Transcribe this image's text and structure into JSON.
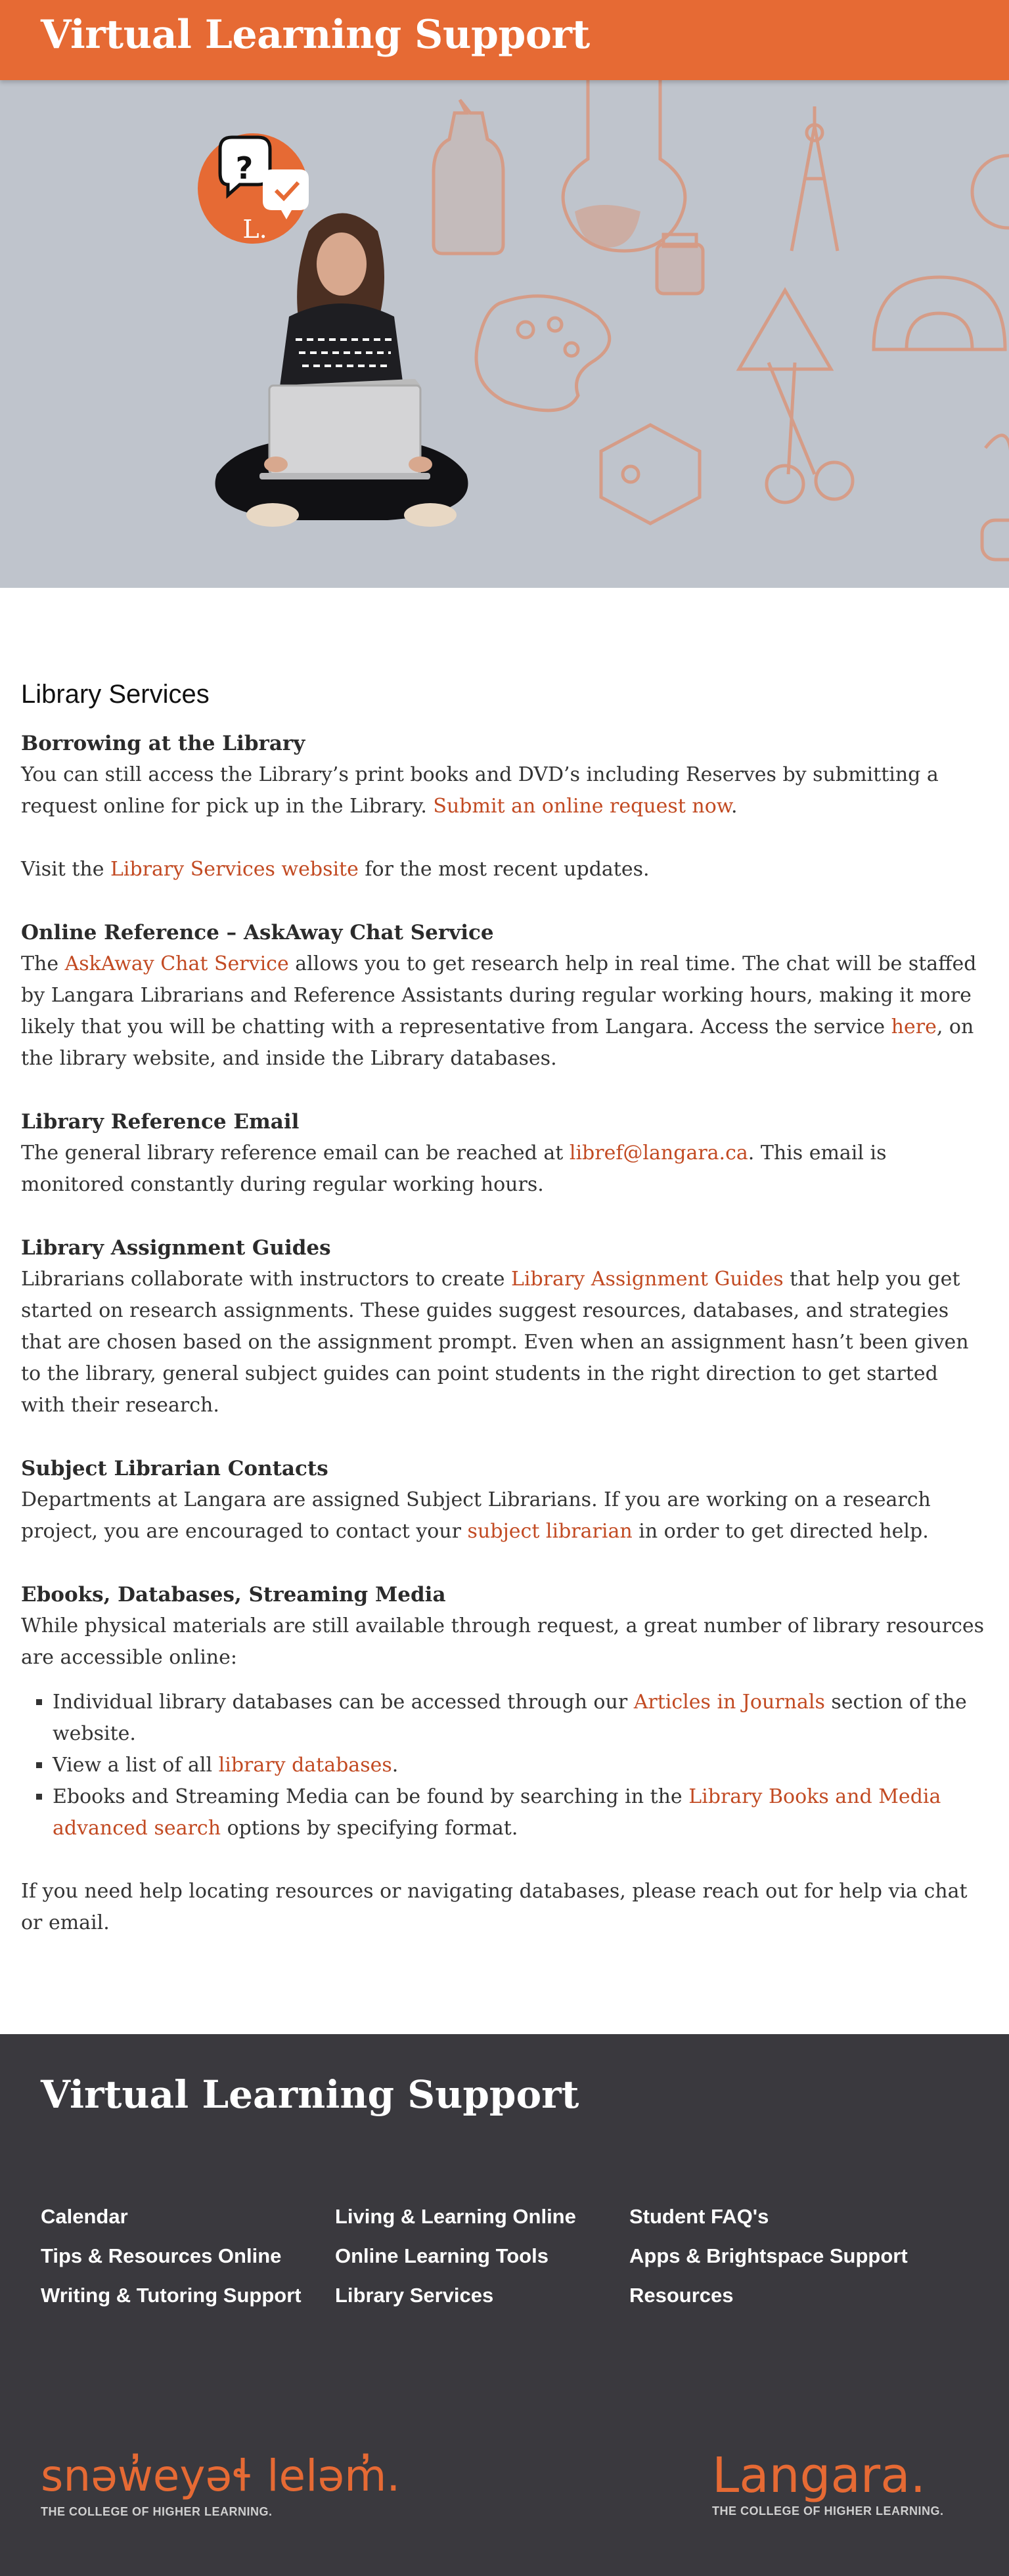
{
  "header": {
    "title": "Virtual Learning Support"
  },
  "hero": {
    "badge_letter": "L."
  },
  "main": {
    "heading": "Library Services",
    "borrowing": {
      "title": "Borrowing at the Library",
      "text": "You can still access the Library’s print books and DVD’s including Reserves by submitting a request online for pick up in the Library. ",
      "link": "Submit an online request now",
      "after": "."
    },
    "visit": {
      "before": "Visit the ",
      "link": "Library Services website",
      "after": " for the most recent updates."
    },
    "askaway": {
      "title": "Online Reference – AskAway Chat Service",
      "before": "The ",
      "link1": "AskAway Chat Service",
      "middle": " allows you to get research help in real time. The chat will be staffed by Langara Librarians and Reference Assistants during regular working hours, making it more likely that you will be chatting with a representative from Langara. Access the service ",
      "link2": "here",
      "after": ", on the library website, and inside the Library databases."
    },
    "email": {
      "title": "Library Reference Email",
      "before": "The general library reference email can be reached at ",
      "link": "libref@langara.ca",
      "after": ". This email is monitored constantly during regular working hours."
    },
    "guides": {
      "title": "Library Assignment Guides",
      "before": "Librarians collaborate with instructors to create ",
      "link": "Library Assignment Guides",
      "after": " that help you get started on research assignments. These guides suggest resources, databases, and strategies that are chosen based on the assignment prompt. Even when an assignment hasn’t been given to the library, general subject guides can point students in the right direction to get started with their research."
    },
    "subject": {
      "title": "Subject Librarian Contacts",
      "before": "Departments at Langara are assigned Subject Librarians. If you are working on a research project, you are encouraged to contact your ",
      "link": "subject librarian",
      "after": " in order to get directed help."
    },
    "ebooks": {
      "title": "Ebooks, Databases, Streaming Media",
      "text": "While physical materials are still available through request, a great number of library resources are accessible online:",
      "items": [
        {
          "before": "Individual library databases can be accessed through our ",
          "link": "Articles in Journals",
          "after": " section of the website."
        },
        {
          "before": "View a list of all ",
          "link": "library databases",
          "after": "."
        },
        {
          "before": "Ebooks and Streaming Media can be found by searching in the ",
          "link": "Library Books and Media advanced search",
          "after": " options by specifying format."
        }
      ]
    },
    "closing": "If you need help locating resources or navigating databases, please reach out for help via chat or email."
  },
  "footer": {
    "title": "Virtual Learning Support",
    "col1": [
      "Calendar",
      "Tips & Resources Online",
      "Writing & Tutoring Support"
    ],
    "col2": [
      "Living & Learning Online",
      "Online Learning Tools",
      "Library Services"
    ],
    "col3": [
      "Student FAQ's",
      "Apps & Brightspace Support",
      "Resources"
    ],
    "logo_left": {
      "name": "snəw̓eyəɬ leləm̓.",
      "tagline": "THE COLLEGE OF HIGHER LEARNING."
    },
    "logo_right": {
      "name": "Langara.",
      "tagline": "THE COLLEGE OF HIGHER LEARNING."
    }
  },
  "colors": {
    "accent": "#e66a34",
    "link": "#c24a22",
    "footer_bg": "#3a393e",
    "hero_bg": "#bfc4cc"
  }
}
